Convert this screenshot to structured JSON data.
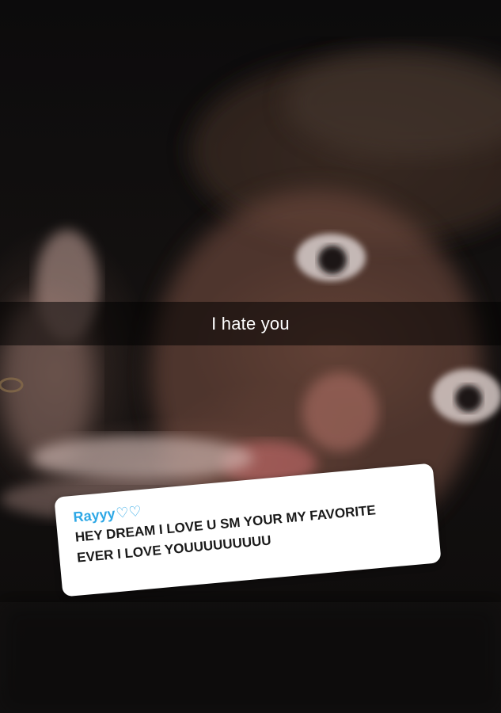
{
  "caption": {
    "text": "I hate you"
  },
  "question_card": {
    "asker": "Rayyy",
    "asker_hearts": "♡♡",
    "message": "HEY DREAM I LOVE U SM YOUR MY FAVORITE EVER I LOVE YOUUUUUUUUU",
    "asker_color": "#2ea8e6"
  },
  "colors": {
    "caption_bar": "#000000",
    "card_background": "#ffffff",
    "message_text": "#1a1a1a"
  }
}
